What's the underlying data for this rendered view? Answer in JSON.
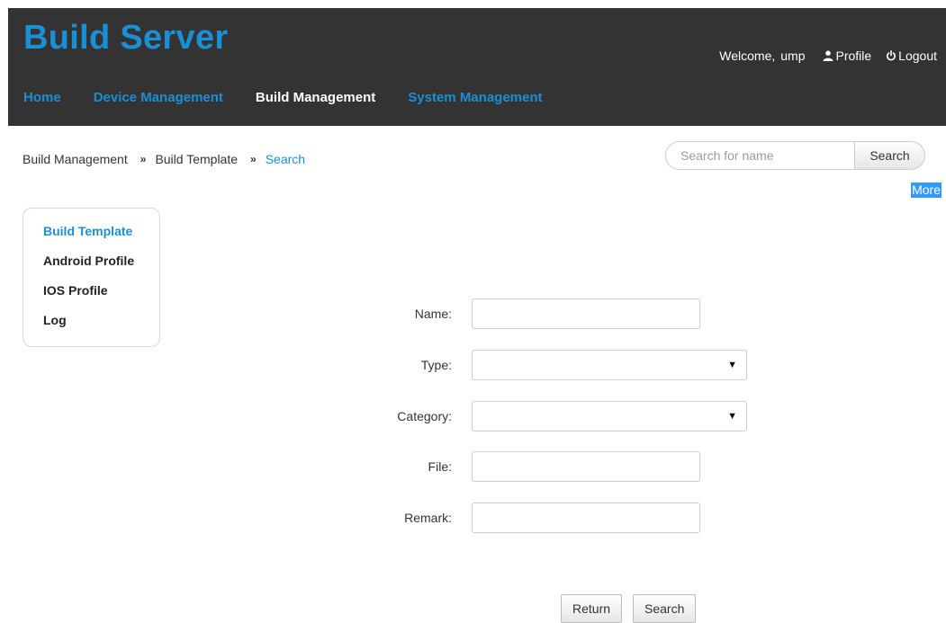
{
  "header": {
    "app_title": "Build Server",
    "welcome": "Welcome,",
    "username": "ump",
    "profile_label": "Profile",
    "logout_label": "Logout"
  },
  "nav": {
    "items": [
      {
        "label": "Home",
        "active": false
      },
      {
        "label": "Device Management",
        "active": false
      },
      {
        "label": "Build Management",
        "active": true
      },
      {
        "label": "System Management",
        "active": false
      }
    ]
  },
  "breadcrumb": {
    "items": [
      "Build Management",
      "Build Template",
      "Search"
    ],
    "separator": "»"
  },
  "search": {
    "placeholder": "Search for name",
    "button_label": "Search",
    "more_label": "More"
  },
  "sidebar": {
    "items": [
      {
        "label": "Build Template",
        "active": true
      },
      {
        "label": "Android Profile",
        "active": false
      },
      {
        "label": "IOS Profile",
        "active": false
      },
      {
        "label": "Log",
        "active": false
      }
    ]
  },
  "form": {
    "name_label": "Name:",
    "name_value": "",
    "type_label": "Type:",
    "type_value": "",
    "category_label": "Category:",
    "category_value": "",
    "file_label": "File:",
    "file_value": "",
    "remark_label": "Remark:",
    "remark_value": ""
  },
  "actions": {
    "return_label": "Return",
    "search_label": "Search"
  },
  "colors": {
    "header_bg": "#333333",
    "accent": "#1a8fd6",
    "highlight": "#3399ff"
  }
}
